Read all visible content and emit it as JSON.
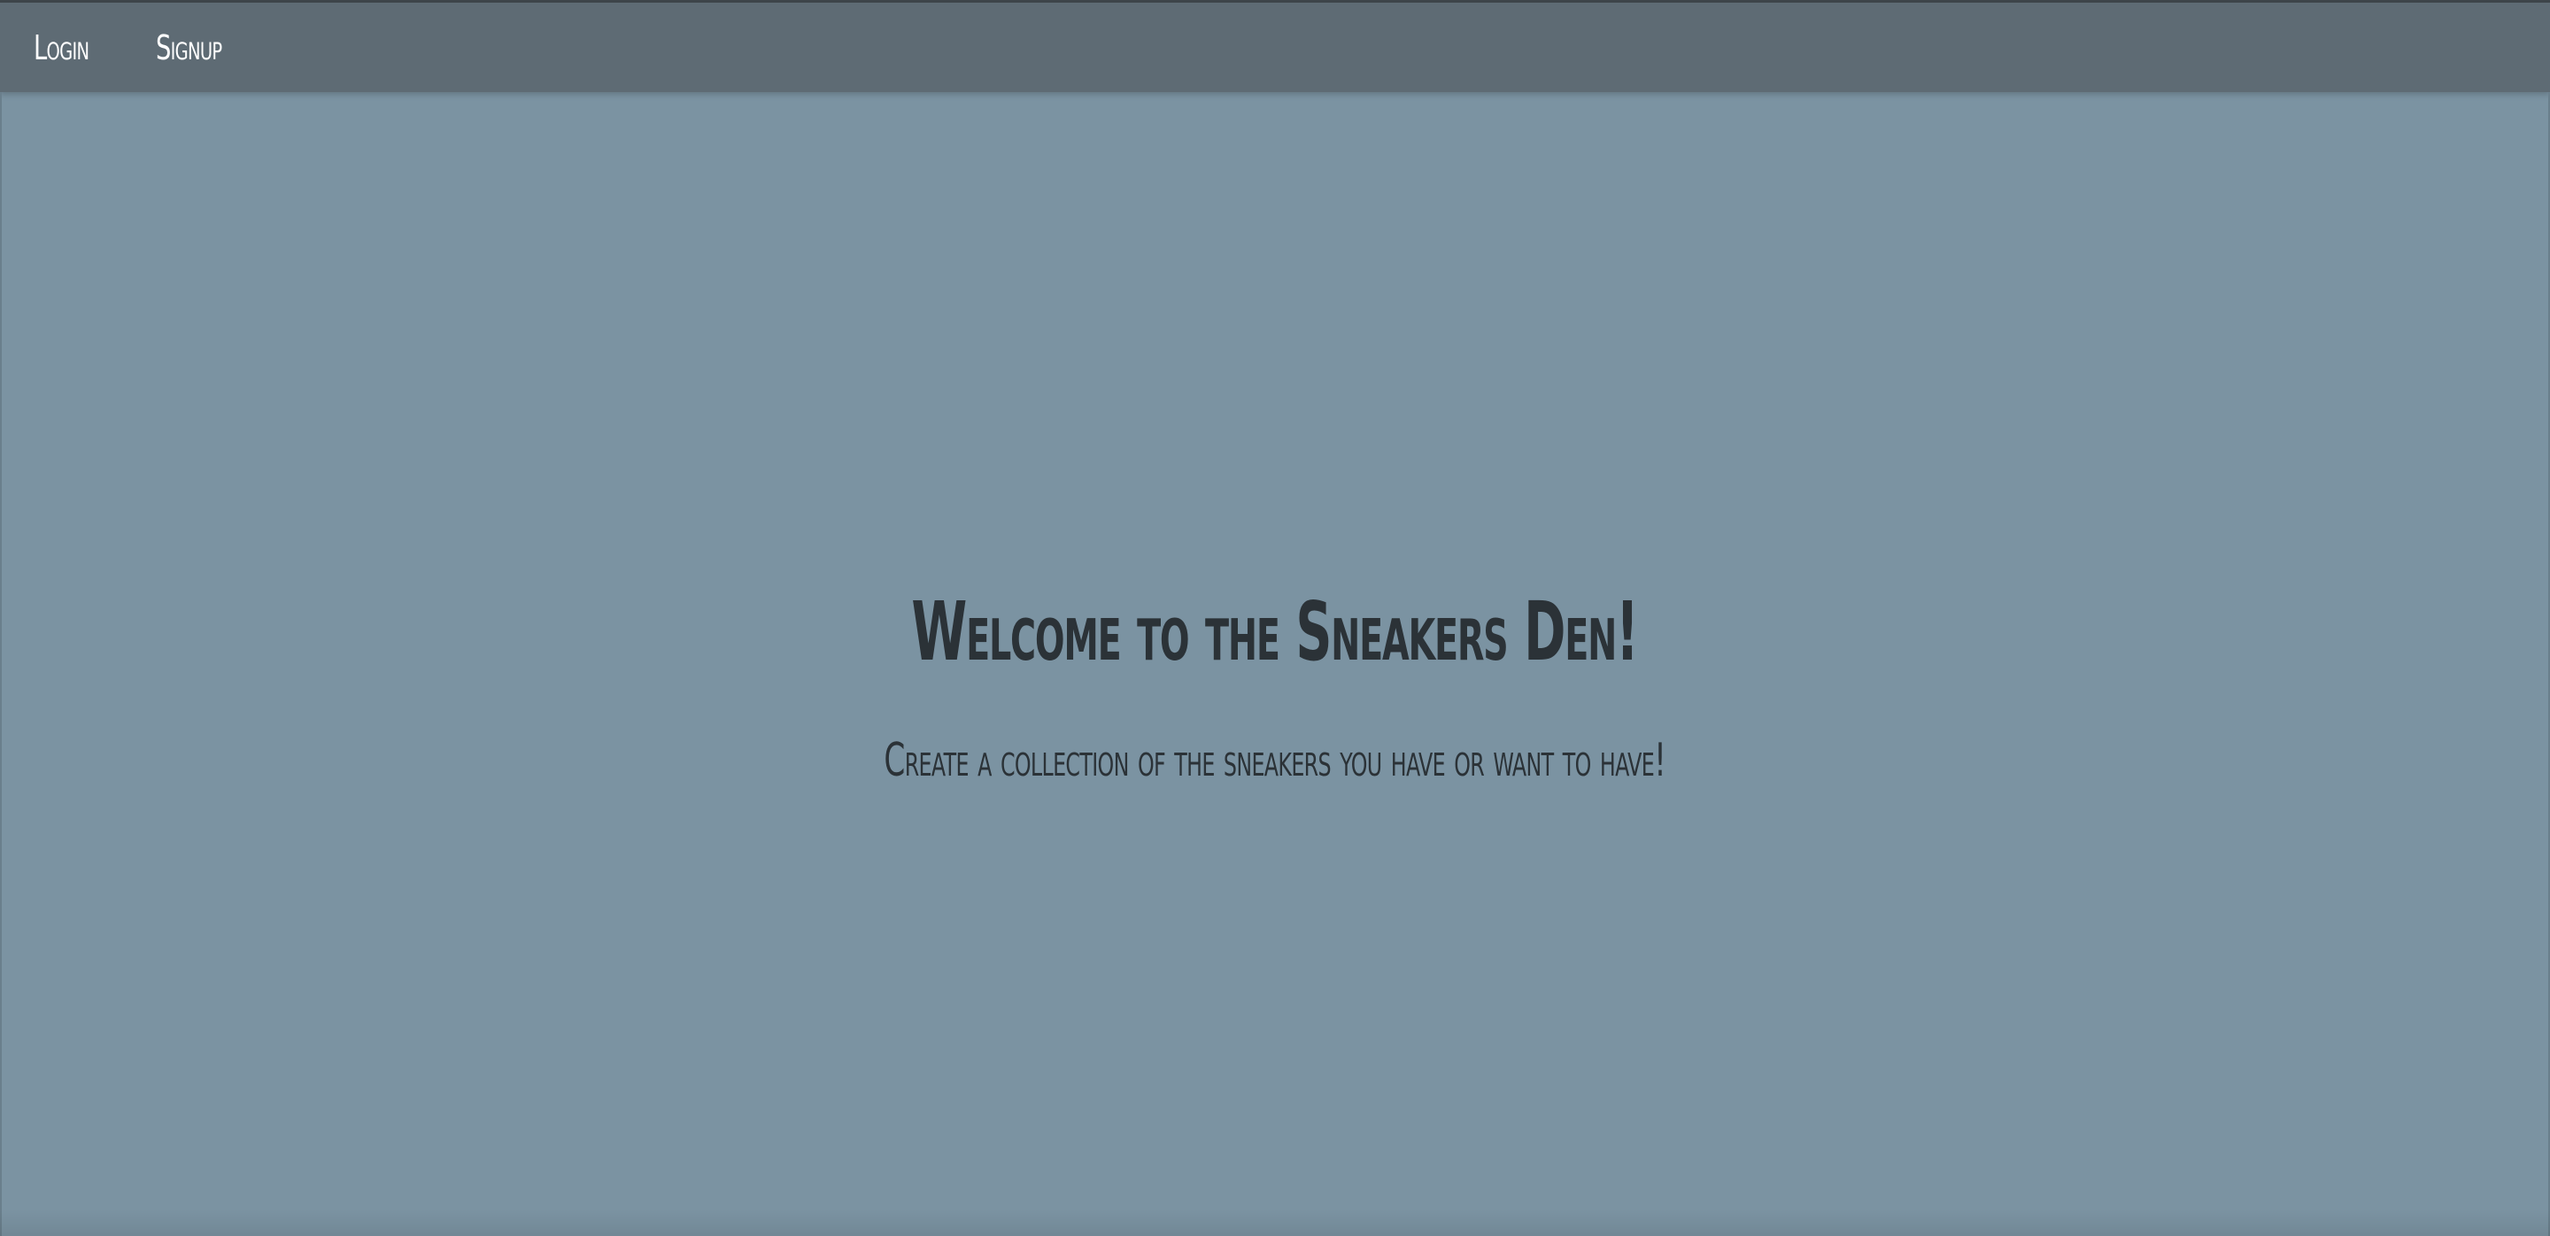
{
  "nav": {
    "login_label": "Login",
    "signup_label": "Signup"
  },
  "hero": {
    "title": "Welcome to the Sneakers Den!",
    "subtitle": "Create a collection of the sneakers you have or want to have!"
  },
  "colors": {
    "background": "#7b93a2",
    "topbar": "#5e6b74",
    "nav_text": "#ffffff",
    "heading_text": "#2b3237"
  }
}
